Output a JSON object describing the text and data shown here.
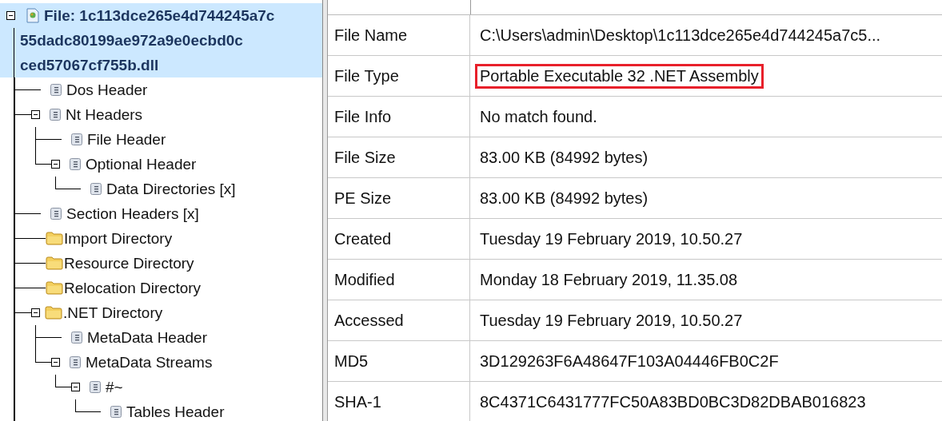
{
  "tree": {
    "label_lines": [
      "File: 1c113dce265e4d744245a7c",
      "55dadc80199ae972a9e0ecbd0c",
      "ced57067cf755b.dll"
    ],
    "selected": true,
    "expanded": true,
    "children": [
      {
        "label": "Dos Header",
        "kind": "item",
        "selected": false,
        "expanded": false
      },
      {
        "label": "Nt Headers",
        "kind": "item",
        "selected": false,
        "expanded": true,
        "children": [
          {
            "label": "File Header",
            "kind": "item",
            "selected": false,
            "expanded": false
          },
          {
            "label": "Optional Header",
            "kind": "item",
            "selected": false,
            "expanded": true,
            "children": [
              {
                "label": "Data Directories [x]",
                "kind": "item",
                "selected": false,
                "expanded": false
              }
            ]
          }
        ]
      },
      {
        "label": "Section Headers [x]",
        "kind": "item",
        "selected": false,
        "expanded": false
      },
      {
        "label": "Import Directory",
        "kind": "folder",
        "selected": false,
        "expanded": false
      },
      {
        "label": "Resource Directory",
        "kind": "folder",
        "selected": false,
        "expanded": false
      },
      {
        "label": "Relocation Directory",
        "kind": "folder",
        "selected": false,
        "expanded": false
      },
      {
        "label": ".NET Directory",
        "kind": "folder",
        "selected": false,
        "expanded": true,
        "children": [
          {
            "label": "MetaData Header",
            "kind": "item",
            "selected": false,
            "expanded": false
          },
          {
            "label": "MetaData Streams",
            "kind": "item",
            "selected": false,
            "expanded": true,
            "children": [
              {
                "label": "#~",
                "kind": "item",
                "selected": false,
                "expanded": true,
                "children": [
                  {
                    "label": "Tables Header",
                    "kind": "item",
                    "selected": false,
                    "expanded": false
                  }
                ]
              }
            ]
          }
        ]
      }
    ]
  },
  "properties": [
    {
      "name": "File Name",
      "value": "C:\\Users\\admin\\Desktop\\1c113dce265e4d744245a7c5...",
      "highlighted": false
    },
    {
      "name": "File Type",
      "value": "Portable Executable 32 .NET Assembly",
      "highlighted": true
    },
    {
      "name": "File Info",
      "value": "No match found.",
      "highlighted": false
    },
    {
      "name": "File Size",
      "value": "83.00 KB (84992 bytes)",
      "highlighted": false
    },
    {
      "name": "PE Size",
      "value": "83.00 KB (84992 bytes)",
      "highlighted": false
    },
    {
      "name": "Created",
      "value": "Tuesday 19 February 2019, 10.50.27",
      "highlighted": false
    },
    {
      "name": "Modified",
      "value": "Monday 18 February 2019, 11.35.08",
      "highlighted": false
    },
    {
      "name": "Accessed",
      "value": "Tuesday 19 February 2019, 10.50.27",
      "highlighted": false
    },
    {
      "name": "MD5",
      "value": "3D129263F6A48647F103A04446FB0C2F",
      "highlighted": false
    },
    {
      "name": "SHA-1",
      "value": "8C4371C6431777FC50A83BD0BC3D82DBAB016823",
      "highlighted": false
    }
  ]
}
